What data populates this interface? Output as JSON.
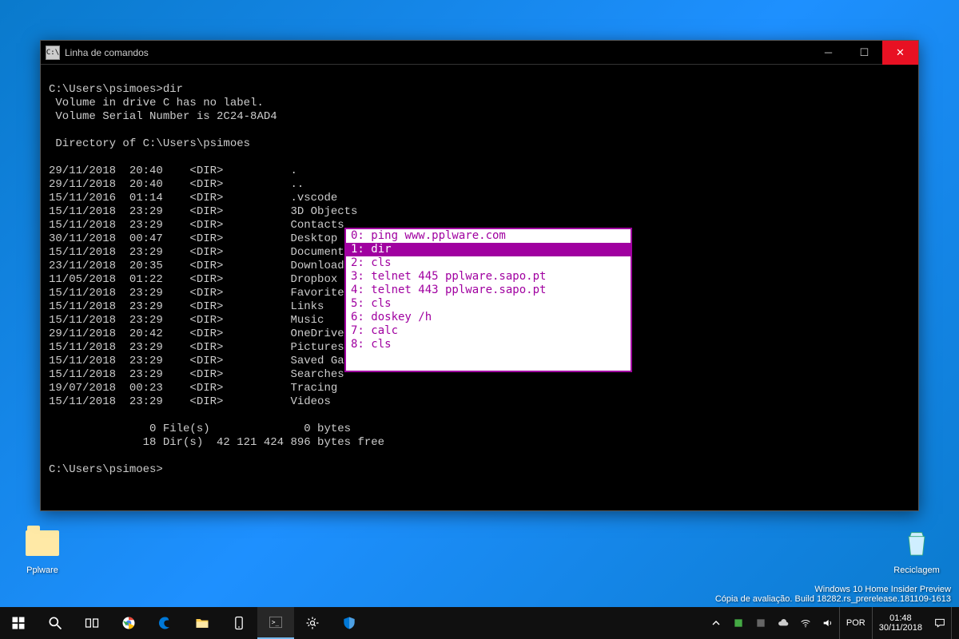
{
  "desktop": {
    "folder_label": "Pplware",
    "bin_label": "Reciclagem"
  },
  "window": {
    "title": "Linha de comandos"
  },
  "terminal": {
    "prompt1": "C:\\Users\\psimoes>dir",
    "vol1": " Volume in drive C has no label.",
    "vol2": " Volume Serial Number is 2C24-8AD4",
    "blank": "",
    "dirof": " Directory of C:\\Users\\psimoes",
    "rows": [
      "29/11/2018  20:40    <DIR>          .",
      "29/11/2018  20:40    <DIR>          ..",
      "15/11/2016  01:14    <DIR>          .vscode",
      "15/11/2018  23:29    <DIR>          3D Objects",
      "15/11/2018  23:29    <DIR>          Contacts",
      "30/11/2018  00:47    <DIR>          Desktop",
      "15/11/2018  23:29    <DIR>          Documents",
      "23/11/2018  20:35    <DIR>          Downloads",
      "11/05/2018  01:22    <DIR>          Dropbox",
      "15/11/2018  23:29    <DIR>          Favorites",
      "15/11/2018  23:29    <DIR>          Links",
      "15/11/2018  23:29    <DIR>          Music",
      "29/11/2018  20:42    <DIR>          OneDrive",
      "15/11/2018  23:29    <DIR>          Pictures",
      "15/11/2018  23:29    <DIR>          Saved Games",
      "15/11/2018  23:29    <DIR>          Searches",
      "19/07/2018  00:23    <DIR>          Tracing",
      "15/11/2018  23:29    <DIR>          Videos"
    ],
    "summary1": "               0 File(s)              0 bytes",
    "summary2": "              18 Dir(s)  42 121 424 896 bytes free",
    "prompt2": "C:\\Users\\psimoes>"
  },
  "history": {
    "items": [
      "0: ping www.pplware.com",
      "1: dir",
      "2: cls",
      "3: telnet 445 pplware.sapo.pt",
      "4: telnet 443 pplware.sapo.pt",
      "5: cls",
      "6: doskey /h",
      "7: calc",
      "8: cls"
    ],
    "selected_index": 1
  },
  "watermark": {
    "line1": "Windows 10 Home Insider Preview",
    "line2": "Cópia de avaliação. Build 18282.rs_prerelease.181109-1613"
  },
  "tray": {
    "lang": "POR",
    "time": "01:48",
    "date": "30/11/2018"
  }
}
